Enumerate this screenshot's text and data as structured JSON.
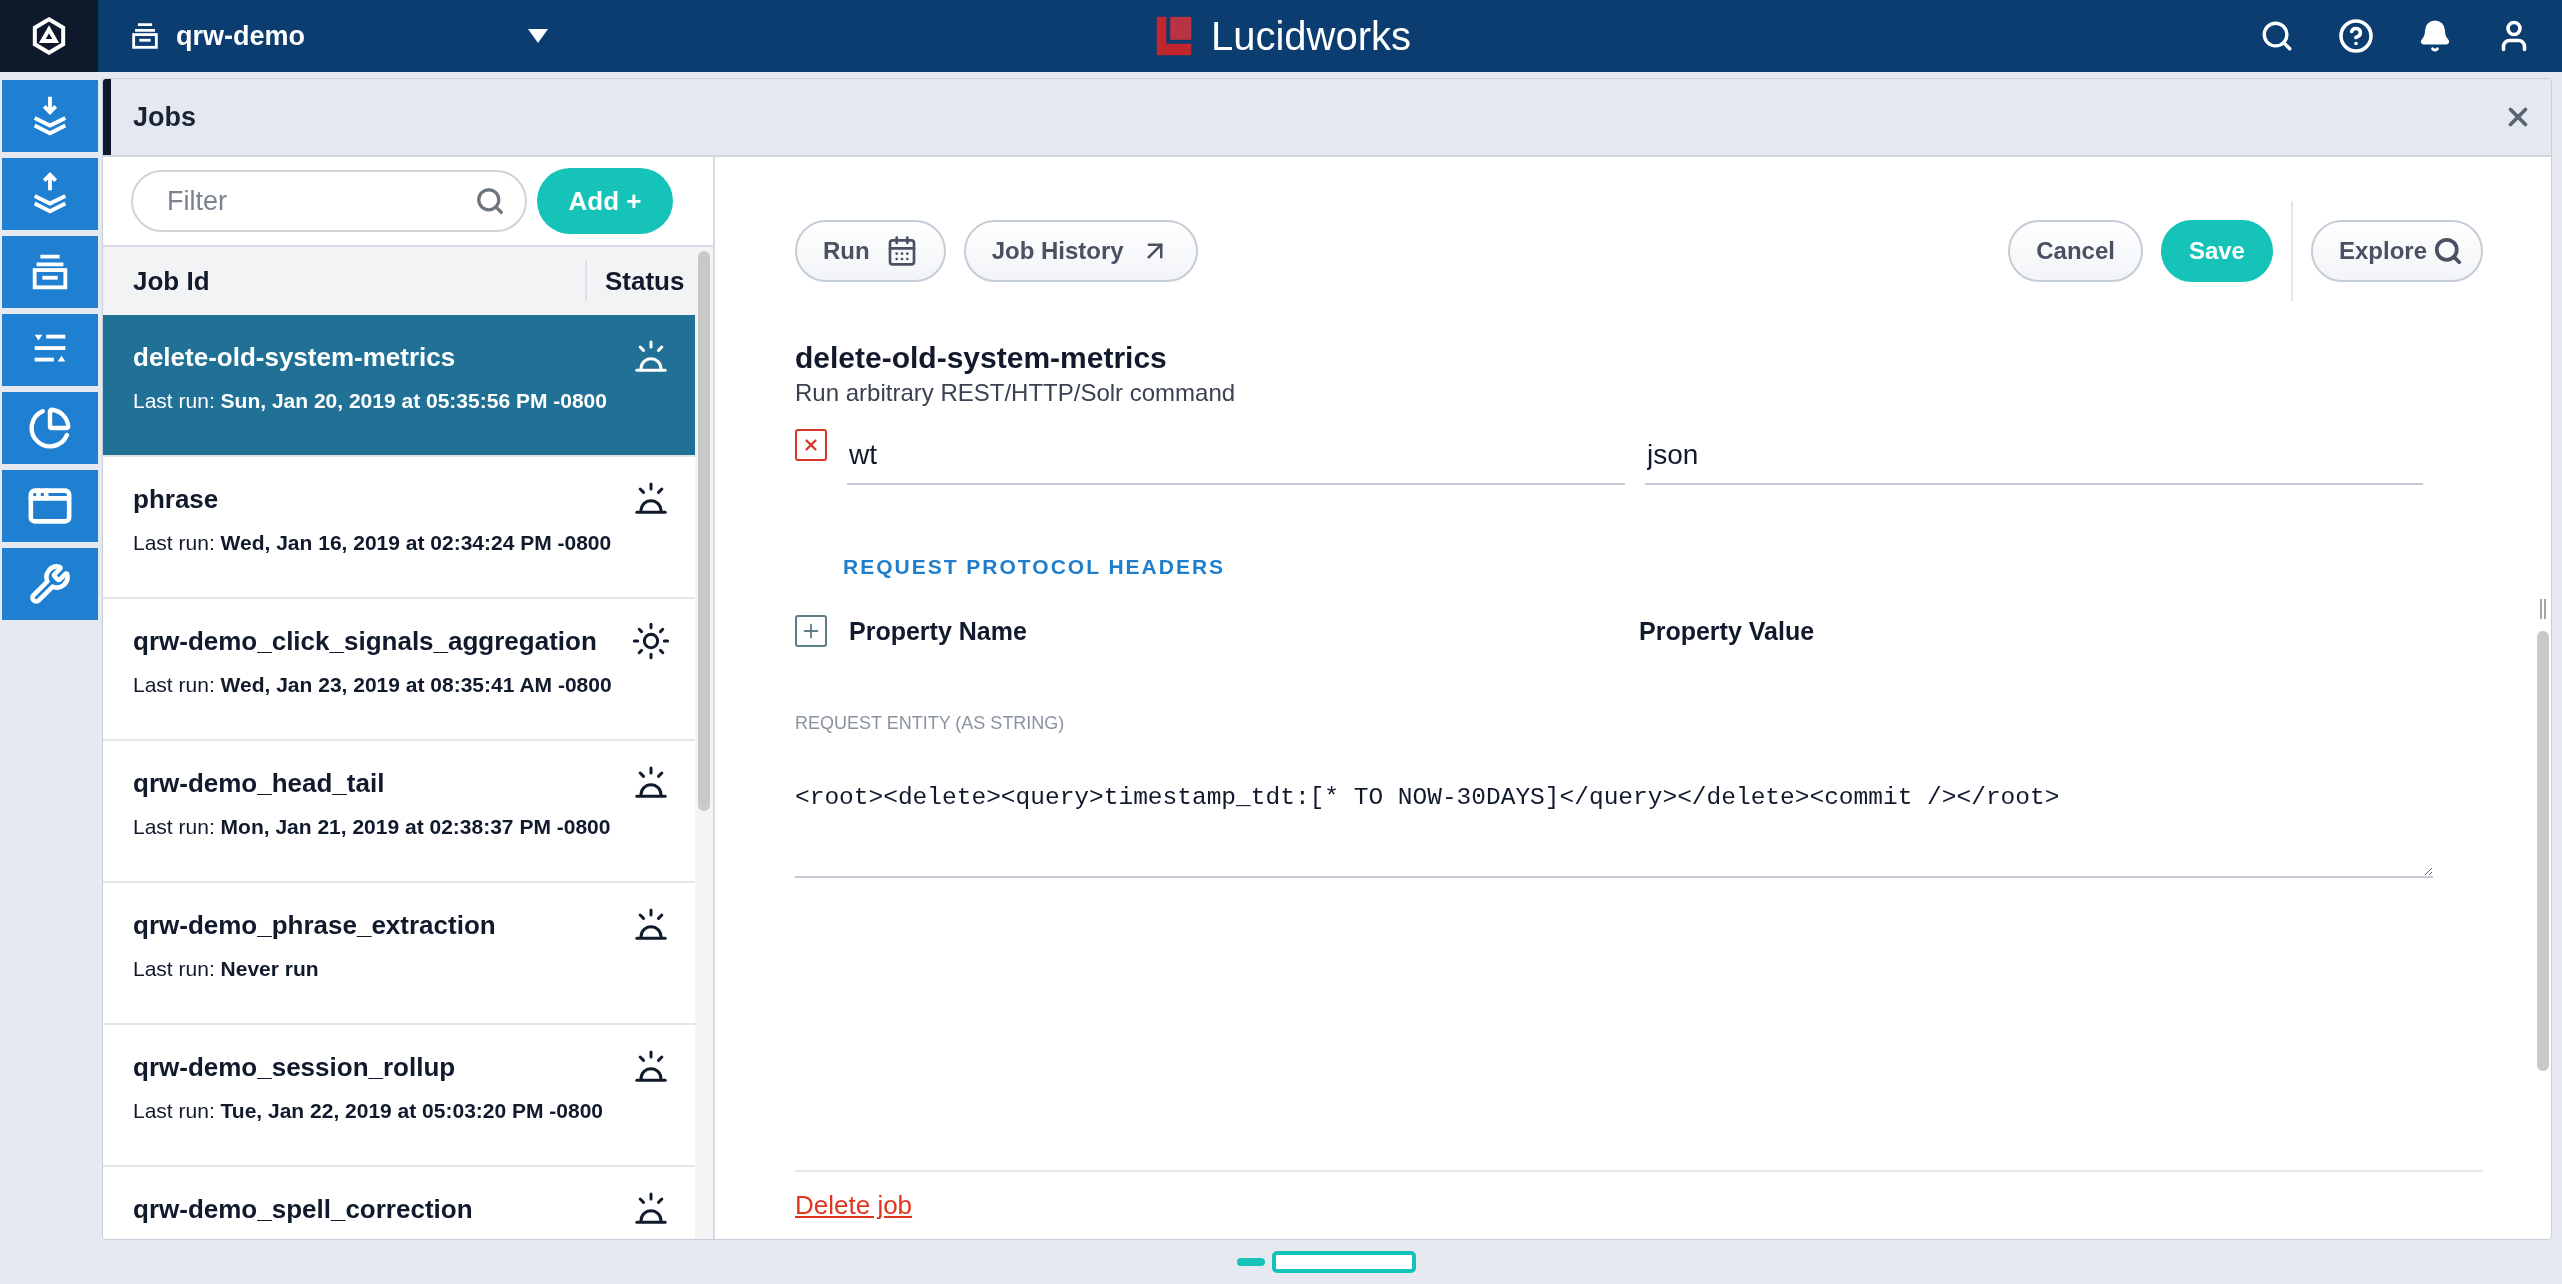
{
  "topbar": {
    "workspace": "qrw-demo",
    "brand": "Lucidworks"
  },
  "panel": {
    "title": "Jobs"
  },
  "filter": {
    "placeholder": "Filter"
  },
  "add_button": {
    "label": "Add +"
  },
  "columns": [
    "Job Id",
    "Status"
  ],
  "jobs": [
    {
      "name": "delete-old-system-metrics",
      "last_run_label": "Last run:",
      "last_run": "Sun, Jan 20, 2019 at 05:35:56 PM -0800",
      "kind": "beacon",
      "selected": true
    },
    {
      "name": "phrase",
      "last_run_label": "Last run:",
      "last_run": "Wed, Jan 16, 2019 at 02:34:24 PM -0800",
      "kind": "beacon",
      "selected": false
    },
    {
      "name": "qrw-demo_click_signals_aggregation",
      "last_run_label": "Last run:",
      "last_run": "Wed, Jan 23, 2019 at 08:35:41 AM -0800",
      "kind": "sun",
      "selected": false
    },
    {
      "name": "qrw-demo_head_tail",
      "last_run_label": "Last run:",
      "last_run": "Mon, Jan 21, 2019 at 02:38:37 PM -0800",
      "kind": "beacon",
      "selected": false
    },
    {
      "name": "qrw-demo_phrase_extraction",
      "last_run_label": "Last run:",
      "last_run": "Never run",
      "kind": "beacon",
      "selected": false
    },
    {
      "name": "qrw-demo_session_rollup",
      "last_run_label": "Last run:",
      "last_run": "Tue, Jan 22, 2019 at 05:03:20 PM -0800",
      "kind": "beacon",
      "selected": false
    },
    {
      "name": "qrw-demo_spell_correction",
      "kind": "beacon",
      "selected": false
    }
  ],
  "toolbar": {
    "left": [
      {
        "label": "Run"
      },
      {
        "label": "Job History"
      }
    ],
    "right": [
      {
        "label": "Cancel",
        "kind": "outline"
      },
      {
        "label": "Save",
        "kind": "primary"
      }
    ],
    "explore": {
      "label": "Explore"
    }
  },
  "job": {
    "title": "delete-old-system-metrics",
    "subtitle": "Run arbitrary REST/HTTP/Solr command"
  },
  "params": [
    {
      "key": "wt",
      "value": "json"
    }
  ],
  "headers": {
    "title": "REQUEST PROTOCOL HEADERS",
    "columns": [
      "Property Name",
      "Property Value"
    ]
  },
  "entity": {
    "label": "REQUEST ENTITY (AS STRING)",
    "value": "<root><delete><query>timestamp_tdt:[* TO NOW-30DAYS]</query></delete><commit /></root>"
  },
  "delete_link": "Delete job"
}
